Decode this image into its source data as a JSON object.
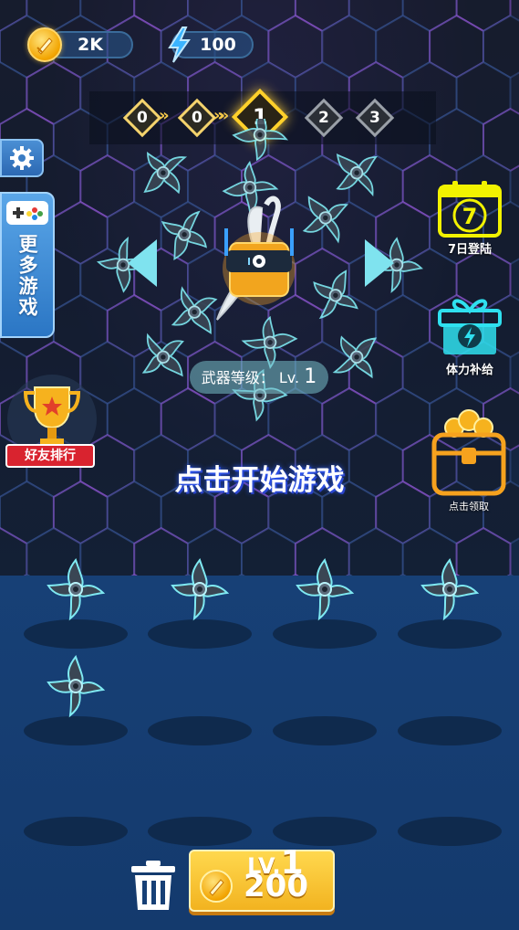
{
  "hud": {
    "coins": "2K",
    "energy": "100"
  },
  "levels": {
    "items": [
      "0",
      "0",
      "1",
      "2",
      "3"
    ],
    "current_index": 2
  },
  "left_menu": {
    "more_games_label": "更多游戏",
    "friend_rank_label": "好友排行"
  },
  "right_menu": {
    "daily_login_label": "7日登陆",
    "daily_login_day": "7",
    "energy_supply_label": "体力补给",
    "claim_label": "点击领取"
  },
  "weapon": {
    "level_prefix": "武器等级：",
    "level_label": "Lv.",
    "level_number": "1"
  },
  "start_prompt": "点击开始游戏",
  "buy_button": {
    "lv_label": "LV.",
    "lv_number": "1",
    "price": "200"
  },
  "colors": {
    "accent_gold": "#ffd12b",
    "arrow_cyan": "#7fe3ef",
    "board_blue": "#174076",
    "neon_yellow": "#f2f200",
    "neon_cyan": "#2fe0ef"
  }
}
